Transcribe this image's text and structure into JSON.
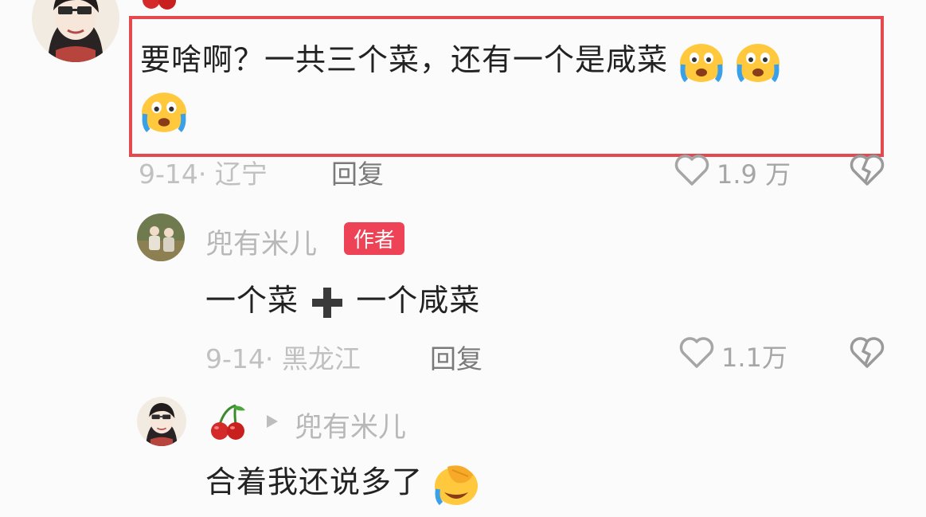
{
  "comment_main": {
    "text": "要啥啊？一共三个菜，还有一个是咸菜",
    "date_location": "9-14· 辽宁",
    "reply_label": "回复",
    "likes": "1.9 万"
  },
  "reply_1": {
    "username": "兜有米儿",
    "badge": "作者",
    "text_part1": "一个菜",
    "text_part2": "一个咸菜",
    "date_location": "9-14· 黑龙江",
    "reply_label": "回复",
    "likes": "1.1万"
  },
  "reply_2": {
    "reply_to": "兜有米儿",
    "text": "合着我还说多了"
  },
  "colors": {
    "highlight_border": "#e24a50",
    "badge_bg": "#ee4257"
  },
  "icons": [
    "heart-outline-icon",
    "broken-heart-icon",
    "crying-emoji-icon",
    "cherry-icon",
    "face-palm-laughing-emoji-icon",
    "plus-icon",
    "play-triangle-icon"
  ]
}
